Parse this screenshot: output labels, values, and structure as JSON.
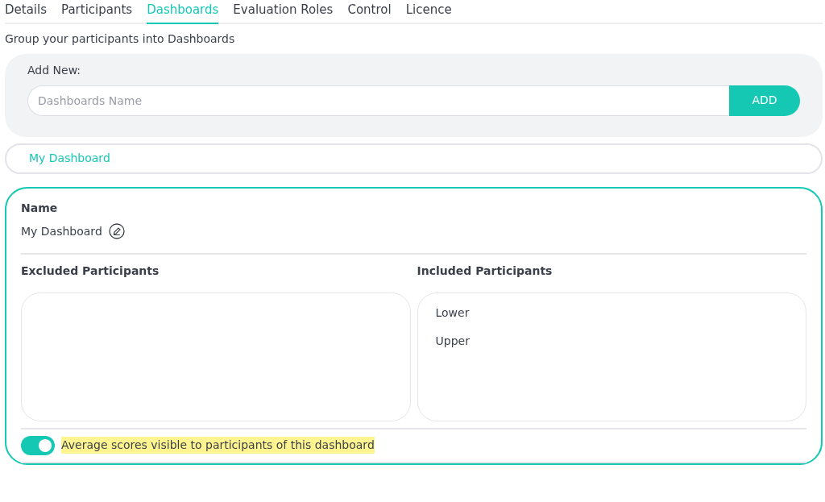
{
  "tabs": [
    {
      "label": "Details",
      "selected": false
    },
    {
      "label": "Participants",
      "selected": false
    },
    {
      "label": "Dashboards",
      "selected": true
    },
    {
      "label": "Evaluation Roles",
      "selected": false
    },
    {
      "label": "Control",
      "selected": false
    },
    {
      "label": "Licence",
      "selected": false
    }
  ],
  "intro": "Group your participants into Dashboards",
  "add_new": {
    "label": "Add New:",
    "placeholder": "Dashboards Name",
    "button": "ADD"
  },
  "dashboards": [
    {
      "label": "My Dashboard",
      "selected": true
    }
  ],
  "editor": {
    "name_label": "Name",
    "name": "My Dashboard",
    "excluded": {
      "title": "Excluded Participants"
    },
    "included": {
      "title": "Included Participants",
      "items": [
        "Lower",
        "Upper"
      ]
    },
    "toggle": {
      "label": "Average scores visible to participants of this dashboard",
      "on": true,
      "highlighted": true
    }
  }
}
